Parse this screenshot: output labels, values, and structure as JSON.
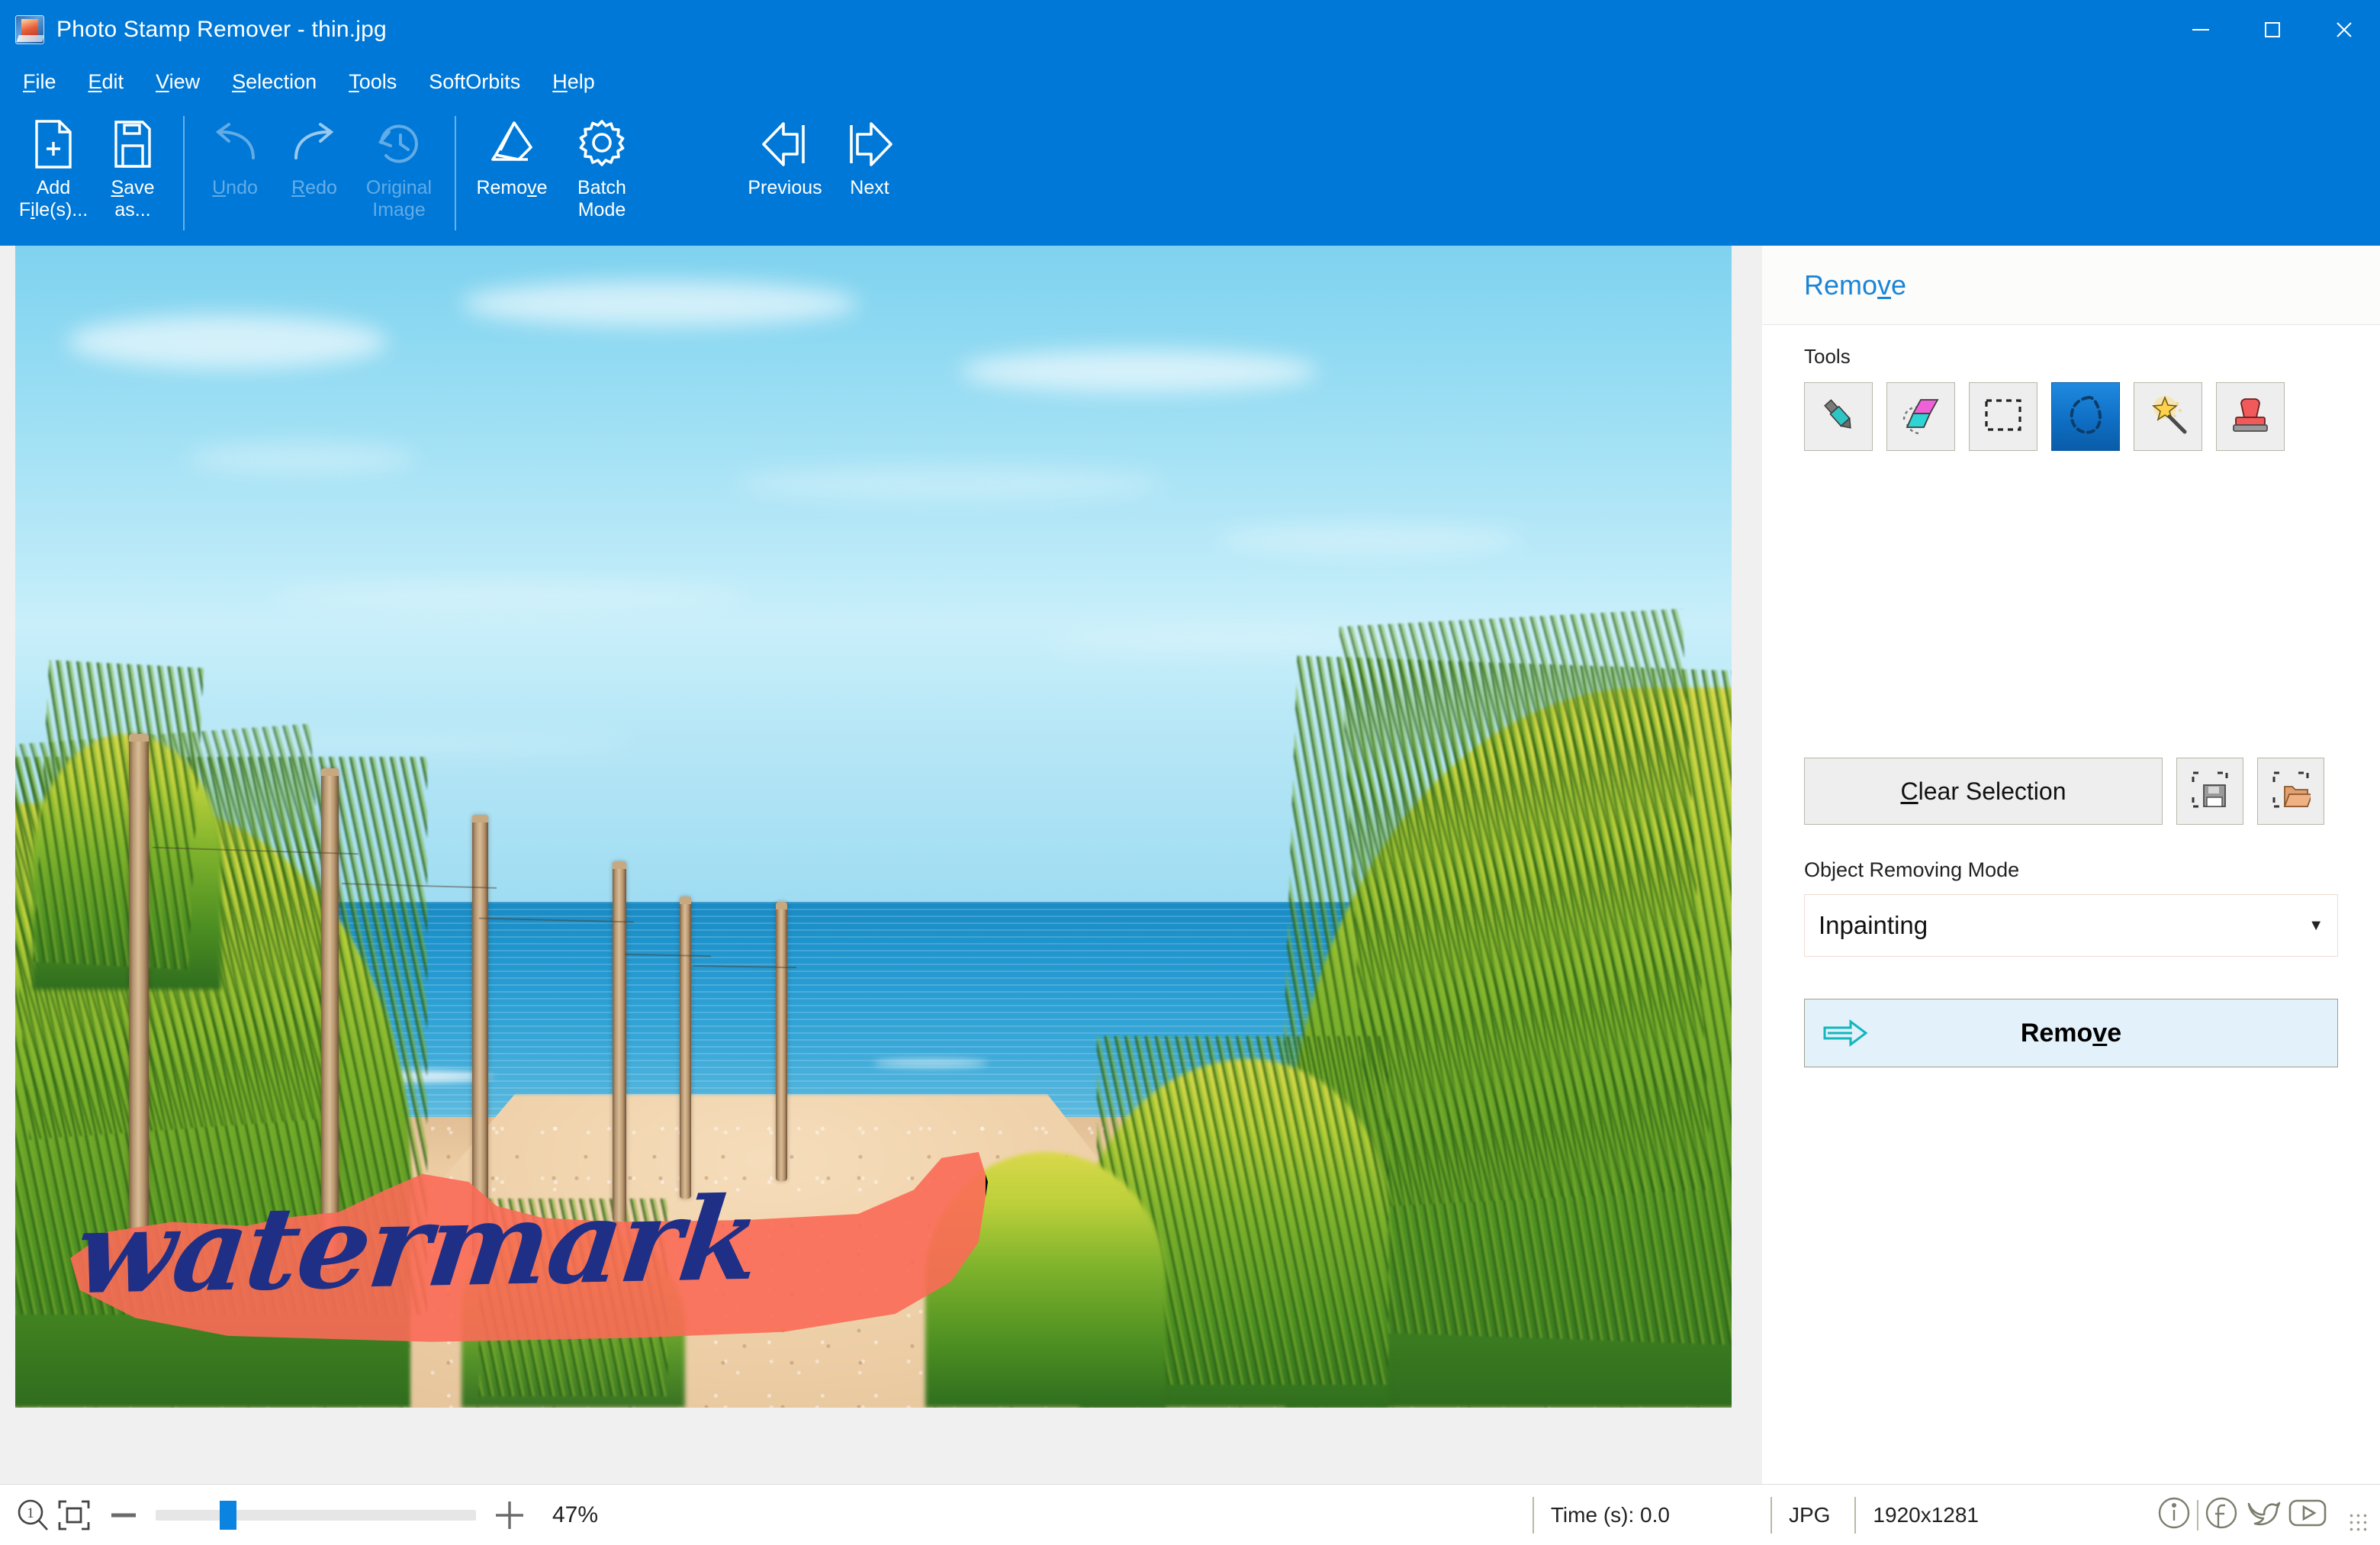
{
  "window": {
    "title": "Photo Stamp Remover - thin.jpg",
    "app_icon": "app-photo-icon",
    "controls": {
      "minimize": "minimize-icon",
      "maximize": "maximize-icon",
      "close": "close-icon"
    },
    "accent_blue": "#0078d7"
  },
  "menubar": {
    "items": [
      {
        "label": "File",
        "accel": "F"
      },
      {
        "label": "Edit",
        "accel": "E"
      },
      {
        "label": "View",
        "accel": "V"
      },
      {
        "label": "Selection",
        "accel": "S"
      },
      {
        "label": "Tools",
        "accel": "T"
      },
      {
        "label": "SoftOrbits",
        "accel": ""
      },
      {
        "label": "Help",
        "accel": "H"
      }
    ]
  },
  "toolbar": {
    "items": [
      {
        "label": "Add\nFile(s)...",
        "icon": "add-file-icon",
        "enabled": true
      },
      {
        "label": "Save\nas...",
        "icon": "save-as-icon",
        "enabled": true
      },
      {
        "label": "Undo",
        "icon": "undo-icon",
        "enabled": false
      },
      {
        "label": "Redo",
        "icon": "redo-icon",
        "enabled": false
      },
      {
        "label": "Original\nImage",
        "icon": "original-image-icon",
        "enabled": false
      },
      {
        "label": "Remove",
        "icon": "eraser-icon",
        "enabled": true
      },
      {
        "label": "Batch\nMode",
        "icon": "gear-icon",
        "enabled": true
      },
      {
        "label": "Previous",
        "icon": "previous-arrow-icon",
        "enabled": true
      },
      {
        "label": "Next",
        "icon": "next-arrow-icon",
        "enabled": true
      }
    ]
  },
  "panel": {
    "title": "Remove",
    "tools_label": "Tools",
    "tools": [
      {
        "name": "marker-tool",
        "icon": "marker-icon",
        "selected": false
      },
      {
        "name": "eraser-tool",
        "icon": "eraser-tool-icon",
        "selected": false
      },
      {
        "name": "rect-select",
        "icon": "rectangle-select-icon",
        "selected": false
      },
      {
        "name": "lasso-select",
        "icon": "lasso-icon",
        "selected": true
      },
      {
        "name": "magic-wand",
        "icon": "magic-wand-icon",
        "selected": false
      },
      {
        "name": "stamp-tool",
        "icon": "stamp-icon",
        "selected": false
      }
    ],
    "clear_selection": "Clear Selection",
    "clear_selection_accel": "C",
    "save_selection_icon": "save-selection-icon",
    "open_selection_icon": "open-selection-icon",
    "mode_label": "Object Removing Mode",
    "mode_value": "Inpainting",
    "mode_options": [
      "Inpainting"
    ],
    "remove_button": "Remove",
    "remove_button_accel": "v",
    "remove_arrow_icon": "arrow-right-icon"
  },
  "canvas": {
    "watermark_text": "watermark",
    "selection_fill": "#fb6a57",
    "watermark_color": "#1f2f86",
    "scene": "beach dune path with wooden fence posts, dune grass, sea and sky"
  },
  "statusbar": {
    "zoom_actual_icon": "zoom-actual-size-icon",
    "zoom_fit_icon": "zoom-fit-icon",
    "zoom_out_icon": "minus-icon",
    "zoom_in_icon": "plus-icon",
    "zoom_percent": "47%",
    "zoom_value": 47,
    "slider_position_pct": 20,
    "time_label": "Time (s): 0.0",
    "format": "JPG",
    "dimensions": "1920x1281",
    "social": [
      {
        "name": "info-icon",
        "glyph": "i"
      },
      {
        "name": "facebook-icon",
        "glyph": "f"
      },
      {
        "name": "twitter-icon",
        "glyph": "t"
      },
      {
        "name": "youtube-icon",
        "glyph": "y"
      }
    ],
    "resize_grip": "resize-grip-icon"
  }
}
